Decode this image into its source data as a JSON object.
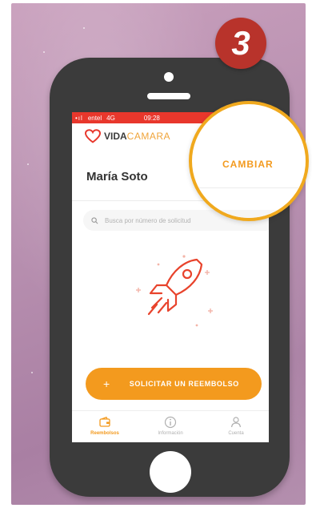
{
  "step_badge": "3",
  "status_bar": {
    "carrier": "entel",
    "network": "4G",
    "time": "09:28"
  },
  "app": {
    "brand_part1": "VIDA",
    "brand_part2": "CAMARA"
  },
  "user_name": "María Soto",
  "change_link": "CAMBIAR",
  "search": {
    "placeholder": "Busca por número de solicitud"
  },
  "cta_label": "SOLICITAR UN REEMBOLSO",
  "bottom_nav": [
    {
      "label": "Reembolsos",
      "icon": "wallet-icon",
      "active": true
    },
    {
      "label": "Información",
      "icon": "info-icon",
      "active": false
    },
    {
      "label": "Cuenta",
      "icon": "user-icon",
      "active": false
    }
  ],
  "colors": {
    "accent": "#f39a1e",
    "status_bar": "#e8372c",
    "badge": "#b8332b",
    "phone_body": "#3b3b3b",
    "background": "#b890b0"
  }
}
